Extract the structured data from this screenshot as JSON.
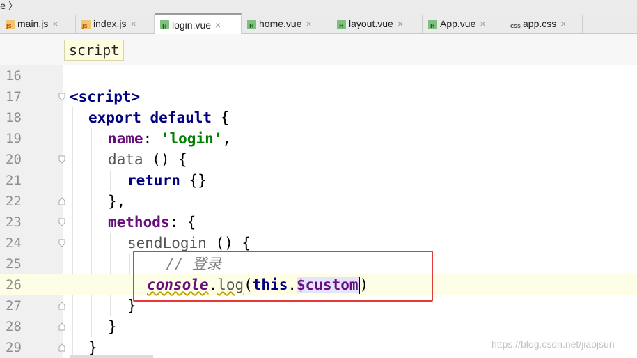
{
  "breadcrumb_top": "e 〉",
  "tabs": [
    {
      "label": "main.js",
      "type": "js",
      "active": false
    },
    {
      "label": "index.js",
      "type": "js",
      "active": false
    },
    {
      "label": "login.vue",
      "type": "vue",
      "active": true
    },
    {
      "label": "home.vue",
      "type": "vue",
      "active": false
    },
    {
      "label": "layout.vue",
      "type": "vue",
      "active": false
    },
    {
      "label": "App.vue",
      "type": "vue",
      "active": false
    },
    {
      "label": "app.css",
      "type": "css",
      "active": false
    }
  ],
  "close_glyph": "×",
  "editor_breadcrumb": "script",
  "line_numbers": [
    "16",
    "17",
    "18",
    "19",
    "20",
    "21",
    "22",
    "23",
    "24",
    "25",
    "26",
    "27",
    "28",
    "29"
  ],
  "code": {
    "l17_tag": "<script>",
    "l18_kw1": "export",
    "l18_kw2": "default",
    "l18_rest": " {",
    "l19_prop": "name",
    "l19_colon": ": ",
    "l19_str": "'login'",
    "l19_comma": ",",
    "l20_fn": "data",
    "l20_rest": " () {",
    "l21_kw": "return",
    "l21_rest": " {}",
    "l22": "},",
    "l23_prop": "methods",
    "l23_rest": ": {",
    "l24_fn": "sendLogin",
    "l24_rest": " () {",
    "l25_cmt": "// 登录",
    "l26_glob": "console",
    "l26_dot": ".",
    "l26_log": "log",
    "l26_paren": "(",
    "l26_this": "this",
    "l26_dot2": ".",
    "l26_dollar": "$custom",
    "l26_close": ")",
    "l27": "}",
    "l28": "}",
    "l29": "}"
  },
  "watermark": "https://blog.csdn.net/jiaojsun"
}
